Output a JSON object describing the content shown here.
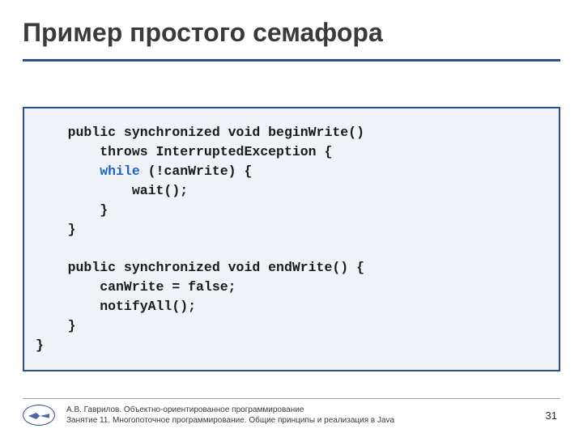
{
  "title": "Пример простого семафора",
  "code": {
    "l1_a": "    public synchronized void beginWrite()",
    "l2_a": "        throws InterruptedException {",
    "l3_a": "        ",
    "l3_kw": "while",
    "l3_b": " (!canWrite) {",
    "l4_a": "            wait();",
    "l5_a": "        }",
    "l6_a": "    }",
    "blank": "",
    "l7_a": "    public synchronized void endWrite() {",
    "l8_a": "        canWrite = false;",
    "l9_a": "        notifyAll();",
    "l10_a": "    }",
    "l11_a": "}"
  },
  "footer": {
    "line1": "А.В. Гаврилов. Объектно-ориентированное программирование",
    "line2": "Занятие 11. Многопоточное программирование. Общие принципы и реализация в Java"
  },
  "page_number": "31"
}
